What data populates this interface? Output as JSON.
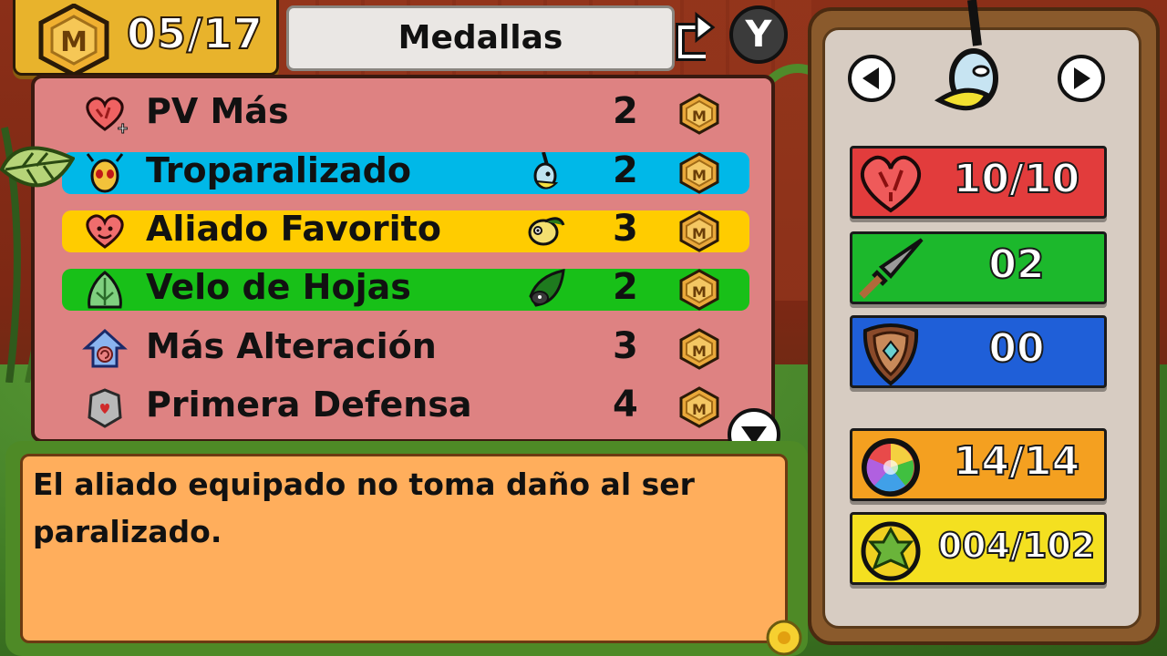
{
  "header": {
    "medal_count": "05/17",
    "title": "Medallas",
    "swap_button": "Y"
  },
  "medals": [
    {
      "label": "PV Más",
      "cost": "2",
      "highlight": "none",
      "icon": "heart-plus-icon",
      "ally": ""
    },
    {
      "label": "Troparalizado",
      "cost": "2",
      "highlight": "#00b8e8",
      "icon": "bug-face-icon",
      "ally": "bird-ally-icon"
    },
    {
      "label": "Aliado Favorito",
      "cost": "3",
      "highlight": "#ffcc00",
      "icon": "smiling-heart-icon",
      "ally": "beetle-ally-icon"
    },
    {
      "label": "Velo de Hojas",
      "cost": "2",
      "highlight": "#18c018",
      "icon": "leaf-veil-icon",
      "ally": "leaf-ally-icon"
    },
    {
      "label": "Más Alteración",
      "cost": "3",
      "highlight": "none",
      "icon": "house-swirl-icon",
      "ally": ""
    },
    {
      "label": "Primera Defensa",
      "cost": "4",
      "highlight": "none",
      "icon": "stone-shield-icon",
      "ally": ""
    }
  ],
  "description": "El aliado equipado no toma daño al ser paralizado.",
  "stats": {
    "hp": {
      "value": "10/10",
      "color": "#e23c3c",
      "icon": "heart-icon"
    },
    "attack": {
      "value": "02",
      "color": "#1cb82c",
      "icon": "sword-icon"
    },
    "defense": {
      "value": "00",
      "color": "#1f5fd8",
      "icon": "shield-icon"
    },
    "tp": {
      "value": "14/14",
      "color": "#f4a020",
      "icon": "rainbow-orb-icon"
    },
    "leaves": {
      "value": "004/102",
      "color": "#f4e020",
      "icon": "leaf-coin-icon"
    }
  }
}
